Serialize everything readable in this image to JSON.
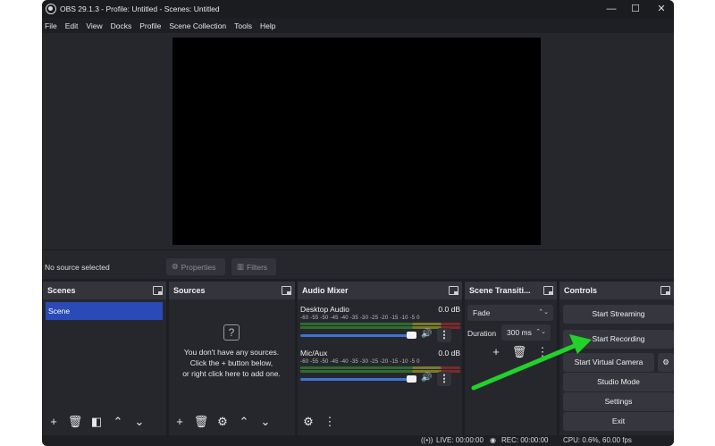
{
  "window": {
    "title": "OBS 29.1.3 - Profile: Untitled - Scenes: Untitled",
    "minimize_glyph": "—",
    "maximize_glyph": "☐",
    "close_glyph": "✕"
  },
  "menu": [
    "File",
    "Edit",
    "View",
    "Docks",
    "Profile",
    "Scene Collection",
    "Tools",
    "Help"
  ],
  "context_bar": {
    "status": "No source selected",
    "properties_label": "Properties",
    "filters_label": "Filters"
  },
  "scenes": {
    "title": "Scenes",
    "items": [
      "Scene"
    ]
  },
  "sources": {
    "title": "Sources",
    "empty_line1": "You don't have any sources.",
    "empty_line2": "Click the + button below,",
    "empty_line3": "or right click here to add one."
  },
  "audio_mixer": {
    "title": "Audio Mixer",
    "scale": "-60 -55 -50 -45 -40 -35 -30 -25 -20 -15 -10 -5 0",
    "channels": [
      {
        "name": "Desktop Audio",
        "db": "0.0 dB",
        "volume_fraction": 0.93
      },
      {
        "name": "Mic/Aux",
        "db": "0.0 dB",
        "volume_fraction": 0.93
      }
    ]
  },
  "transitions": {
    "title": "Scene Transiti...",
    "selected": "Fade",
    "duration_label": "Duration",
    "duration_value": "300 ms"
  },
  "controls": {
    "title": "Controls",
    "start_streaming": "Start Streaming",
    "start_recording": "Start Recording",
    "start_virtual_camera": "Start Virtual Camera",
    "studio_mode": "Studio Mode",
    "settings": "Settings",
    "exit": "Exit"
  },
  "status_bar": {
    "live": "LIVE: 00:00:00",
    "rec": "REC: 00:00:00",
    "cpu": "CPU: 0.6%, 60.00 fps"
  },
  "colors": {
    "accent_selected": "#2a4ab8",
    "volume_slider": "#3b73d6",
    "annotation_arrow": "#22d12a"
  }
}
